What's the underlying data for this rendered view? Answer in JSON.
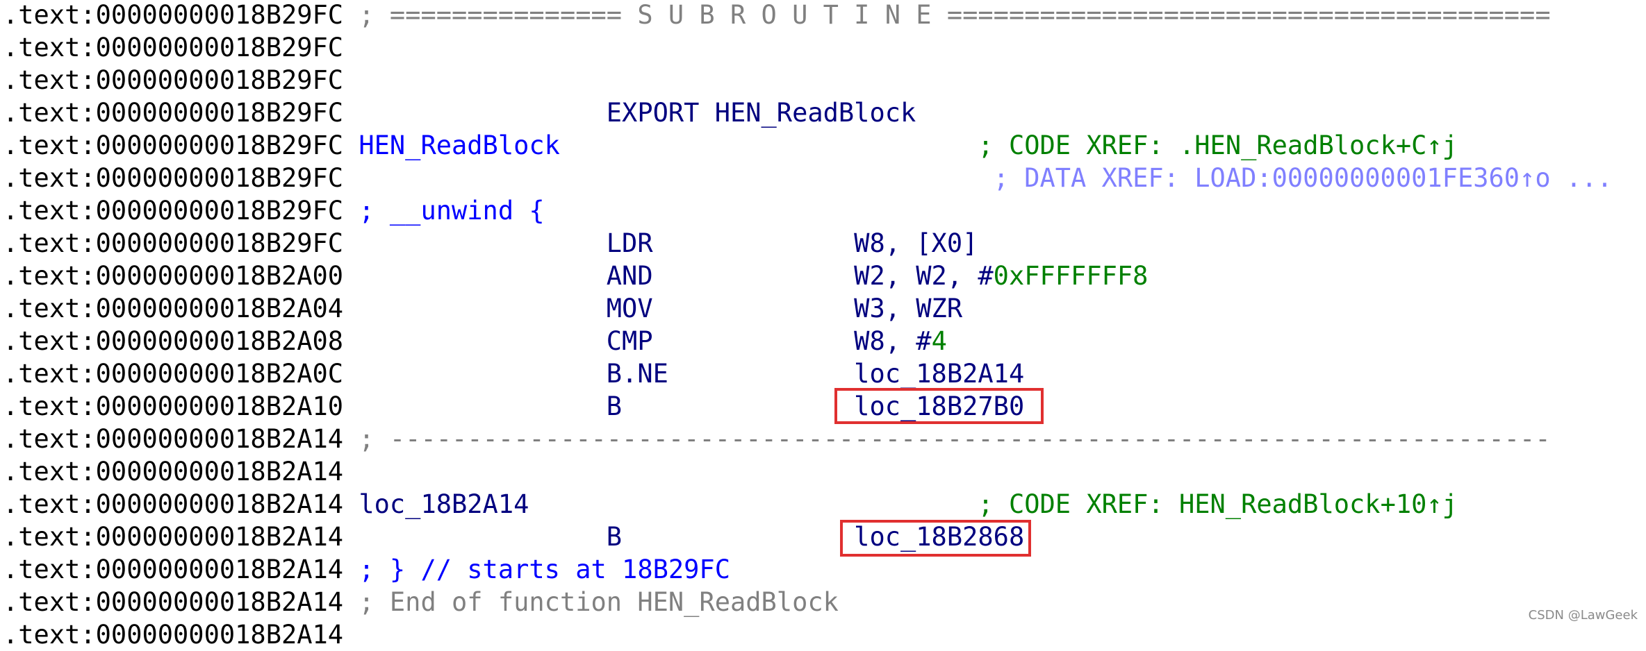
{
  "listing": {
    "lines": [
      {
        "segments": [
          {
            "kind": "addr",
            "text": ".text:00000000018B29FC"
          },
          {
            "kind": "sep",
            "text": " ; =============== S U B R O U T I N E ======================================="
          }
        ]
      },
      {
        "segments": [
          {
            "kind": "addr",
            "text": ".text:00000000018B29FC"
          }
        ]
      },
      {
        "segments": [
          {
            "kind": "addr",
            "text": ".text:00000000018B29FC"
          }
        ]
      },
      {
        "segments": [
          {
            "kind": "addr",
            "text": ".text:00000000018B29FC"
          },
          {
            "kind": "ins",
            "text": "                 EXPORT HEN_ReadBlock"
          }
        ]
      },
      {
        "segments": [
          {
            "kind": "addr",
            "text": ".text:00000000018B29FC"
          },
          {
            "kind": "name",
            "text": " HEN_ReadBlock"
          },
          {
            "kind": "cmt",
            "text": "                           ; CODE XREF: .HEN_ReadBlock+C↑j"
          }
        ]
      },
      {
        "segments": [
          {
            "kind": "addr",
            "text": ".text:00000000018B29FC"
          },
          {
            "kind": "cmt2",
            "text": "                                          ; DATA XREF: LOAD:00000000001FE360↑o ..."
          }
        ]
      },
      {
        "segments": [
          {
            "kind": "addr",
            "text": ".text:00000000018B29FC"
          },
          {
            "kind": "unw",
            "text": " ; __unwind {"
          }
        ]
      },
      {
        "segments": [
          {
            "kind": "addr",
            "text": ".text:00000000018B29FC"
          },
          {
            "kind": "ins",
            "text": "                 LDR             W8, [X0]"
          }
        ]
      },
      {
        "segments": [
          {
            "kind": "addr",
            "text": ".text:00000000018B2A00"
          },
          {
            "kind": "ins",
            "text": "                 AND             W2, W2, #"
          },
          {
            "kind": "num",
            "text": "0xFFFFFFF8"
          }
        ]
      },
      {
        "segments": [
          {
            "kind": "addr",
            "text": ".text:00000000018B2A04"
          },
          {
            "kind": "ins",
            "text": "                 MOV             W3, WZR"
          }
        ]
      },
      {
        "segments": [
          {
            "kind": "addr",
            "text": ".text:00000000018B2A08"
          },
          {
            "kind": "ins",
            "text": "                 CMP             W8, #"
          },
          {
            "kind": "num",
            "text": "4"
          }
        ]
      },
      {
        "segments": [
          {
            "kind": "addr",
            "text": ".text:00000000018B2A0C"
          },
          {
            "kind": "ins",
            "text": "                 B.NE            loc_18B2A14"
          }
        ]
      },
      {
        "segments": [
          {
            "kind": "addr",
            "text": ".text:00000000018B2A10"
          },
          {
            "kind": "ins",
            "text": "                 B               loc_18B27B0"
          }
        ]
      },
      {
        "segments": [
          {
            "kind": "addr",
            "text": ".text:00000000018B2A14"
          },
          {
            "kind": "sep",
            "text": " ; ---------------------------------------------------------------------------"
          }
        ]
      },
      {
        "segments": [
          {
            "kind": "addr",
            "text": ".text:00000000018B2A14"
          }
        ]
      },
      {
        "segments": [
          {
            "kind": "addr",
            "text": ".text:00000000018B2A14"
          },
          {
            "kind": "op",
            "text": " loc_18B2A14"
          },
          {
            "kind": "cmt",
            "text": "                             ; CODE XREF: HEN_ReadBlock+10↑j"
          }
        ]
      },
      {
        "segments": [
          {
            "kind": "addr",
            "text": ".text:00000000018B2A14"
          },
          {
            "kind": "ins",
            "text": "                 B               loc_18B2868"
          }
        ]
      },
      {
        "segments": [
          {
            "kind": "addr",
            "text": ".text:00000000018B2A14"
          },
          {
            "kind": "unw",
            "text": " ; } // starts at 18B29FC"
          }
        ]
      },
      {
        "segments": [
          {
            "kind": "addr",
            "text": ".text:00000000018B2A14"
          },
          {
            "kind": "end",
            "text": " ; End of function HEN_ReadBlock"
          }
        ]
      },
      {
        "segments": [
          {
            "kind": "addr",
            "text": ".text:00000000018B2A14"
          }
        ]
      }
    ]
  },
  "highlights": [
    {
      "label": "loc_18B27B0"
    },
    {
      "label": "loc_18B2868"
    }
  ],
  "watermark": "CSDN @LawGeek",
  "colors": {
    "address": "#000000",
    "instruction": "#00007f",
    "name": "#0000ff",
    "comment": "#008000",
    "data_xref": "#8080ff",
    "separator": "#808080",
    "highlight_border": "#e03030"
  }
}
